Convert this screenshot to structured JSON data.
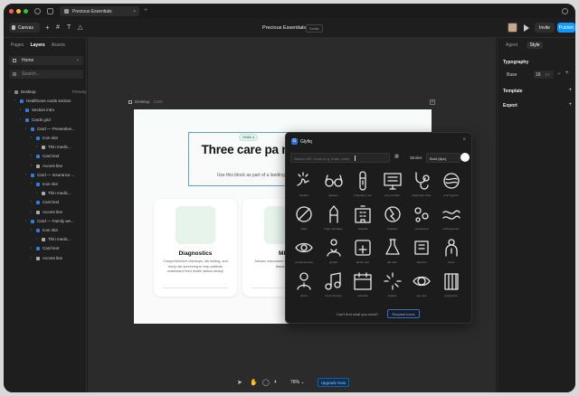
{
  "titlebar": {
    "tab_label": "Precious Essentials",
    "tab_close": "×",
    "new_tab": "+"
  },
  "toolbar": {
    "canvas_label": "Canvas",
    "project_title": "Precious Essentials",
    "drafts_badge": "Drafts",
    "invite_label": "Invite",
    "publish_label": "Publish",
    "accent_color": "#0d99ff"
  },
  "left_panel": {
    "tabs": [
      "Pages",
      "Layers",
      "Assets"
    ],
    "active_tab": "Layers",
    "page_select": "Home",
    "search_placeholder": "Search...",
    "layers": [
      {
        "label": "Desktop",
        "side": "Primary",
        "icon": "frame-icon",
        "color": "#888888"
      },
      {
        "label": "Healthcare cards section",
        "icon": "stack-icon",
        "color": "#2f7de1"
      },
      {
        "label": "Section intro",
        "icon": "stack-icon",
        "color": "#2f7de1"
      },
      {
        "label": "Cards grid",
        "icon": "grid-icon",
        "color": "#2f7de1"
      },
      {
        "label": "Card — Preventive...",
        "icon": "stack-icon",
        "color": "#2f7de1"
      },
      {
        "label": "Icon slot",
        "icon": "stack-icon",
        "color": "#2f7de1"
      },
      {
        "label": "Thin medic...",
        "icon": "vector-icon",
        "color": "#aaaaaa"
      },
      {
        "label": "Card text",
        "icon": "stack-icon",
        "color": "#2f7de1"
      },
      {
        "label": "Accent line",
        "icon": "line-icon",
        "color": "#aaaaaa"
      },
      {
        "label": "Card — Insurance ...",
        "icon": "stack-icon",
        "color": "#2f7de1"
      },
      {
        "label": "Icon slot",
        "icon": "stack-icon",
        "color": "#2f7de1"
      },
      {
        "label": "Thin medic...",
        "icon": "vector-icon",
        "color": "#aaaaaa"
      },
      {
        "label": "Card text",
        "icon": "stack-icon",
        "color": "#2f7de1"
      },
      {
        "label": "Accent line",
        "icon": "line-icon",
        "color": "#aaaaaa"
      },
      {
        "label": "Card — Family we...",
        "icon": "stack-icon",
        "color": "#2f7de1"
      },
      {
        "label": "Icon slot",
        "icon": "stack-icon",
        "color": "#2f7de1"
      },
      {
        "label": "Thin medic...",
        "icon": "vector-icon",
        "color": "#aaaaaa"
      },
      {
        "label": "Card text",
        "icon": "stack-icon",
        "color": "#2f7de1"
      },
      {
        "label": "Accent line",
        "icon": "line-icon",
        "color": "#aaaaaa"
      }
    ]
  },
  "canvas": {
    "frame_label": "Desktop",
    "frame_size": "1200",
    "badge": "Health a",
    "title": "Three care pa medical or insu",
    "subtitle": "Use this block as part of a landing a your own and adapt the copy fo",
    "cards": [
      {
        "title": "Diagnostics",
        "desc": "Comprehensive checkups, lab testing, and early risk screening to help patients understand their health status clearly."
      },
      {
        "title": "MRI",
        "desc": "Advanc resonance ima examinatio soft tissue, and"
      }
    ]
  },
  "glyphy": {
    "title": "Glyfiq",
    "search_placeholder": "Search 637 icons (e.g. brain, pain)",
    "stroke_label": "Stroke:",
    "stroke_value": "Bold (8px)",
    "icon_labels": [
      "sanitize",
      "glasses",
      "pregnancy test",
      "cms provider",
      "diagnostic scan",
      "oral hygiene",
      "tablet",
      "finger bandage",
      "hospital",
      "migraine",
      "operational",
      "pathogenesis",
      "comprehensive",
      "growth",
      "family care",
      "lab tube",
      "intercom",
      "nurse",
      "doctor",
      "music therapy",
      "calendar",
      "sparkle",
      "eye care",
      "paperwork"
    ],
    "footer_text": "Can't find what you need?",
    "request_label": "Request icons"
  },
  "right_panel": {
    "tabs": [
      "Agent",
      "Style"
    ],
    "active_tab": "Style",
    "typography_label": "Typography",
    "base_label": "Base",
    "base_size": "16",
    "base_unit": "PX",
    "template_label": "Template",
    "export_label": "Export"
  },
  "bottom_bar": {
    "zoom": "76%",
    "upgrade_label": "Upgrade Now"
  }
}
